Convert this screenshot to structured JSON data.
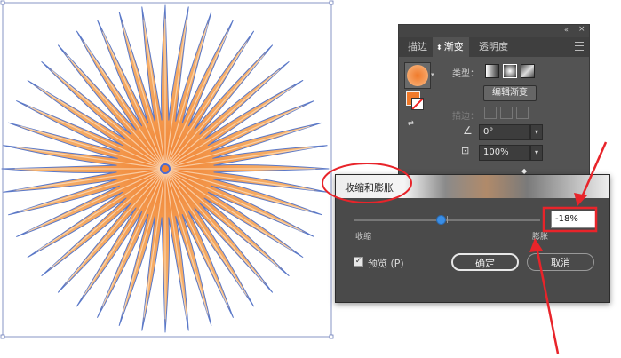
{
  "panel": {
    "tabs": [
      "描边",
      "渐变",
      "透明度"
    ],
    "type_label": "类型：",
    "edit_gradient_button": "编辑渐变",
    "stroke_label": "描边：",
    "angle_value": "0°",
    "aspect_value": "100%"
  },
  "dialog": {
    "title": "收缩和膨胀",
    "slider": {
      "left_label": "收缩",
      "right_label": "膨胀",
      "value": -18
    },
    "value_text": "-18%",
    "preview_label": "预览 (P)",
    "preview_checked": true,
    "ok_button": "确定",
    "cancel_button": "取消"
  },
  "colors": {
    "petal_fill": "#f5a860",
    "petal_stroke": "#5a78c8",
    "highlight_red": "#e8242a",
    "panel_bg": "#535353",
    "slider_thumb": "#3a8ee6"
  }
}
